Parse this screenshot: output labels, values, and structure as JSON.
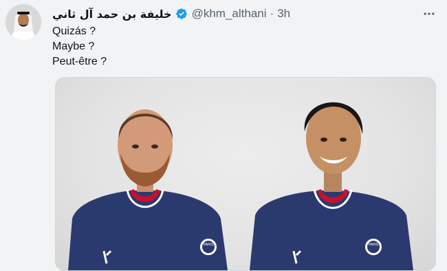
{
  "tweet": {
    "display_name": "خليفة بن حمد آل ثاني",
    "handle": "@khm_althani",
    "separator": "·",
    "time": "3h",
    "lines": [
      "Quizás ?",
      "Maybe ?",
      "Peut-être ?"
    ],
    "media": {
      "jersey_badge_text": "PARIS"
    }
  },
  "colors": {
    "verified": "#1d9bf0",
    "jersey": "#2b3a6e",
    "jersey_trim": "#c8102e",
    "secondary_text": "#536471"
  },
  "icons": {
    "verified": "verified-badge-icon",
    "more": "more-options-icon"
  }
}
